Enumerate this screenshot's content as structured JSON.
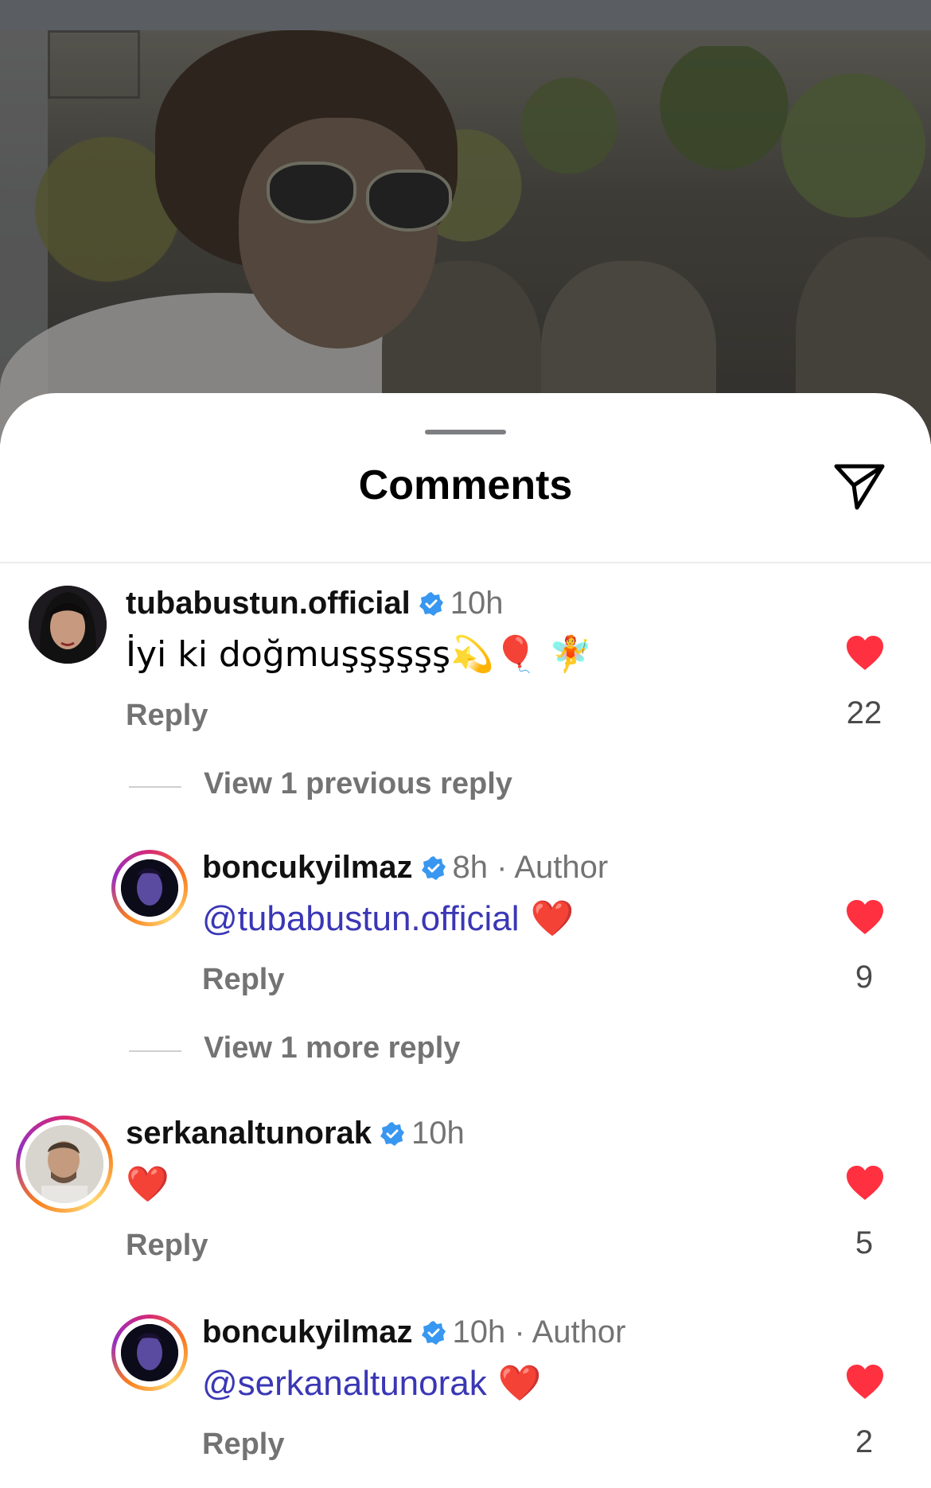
{
  "sheet": {
    "title": "Comments"
  },
  "comments": [
    {
      "username": "tubabustun.official",
      "time": "10h",
      "author_tag": "",
      "text": "İyi ki doğmuşşşşşş💫🎈 🧚",
      "mention": "",
      "reply_label": "Reply",
      "likes": "22",
      "liked": true
    },
    {
      "username": "boncukyilmaz",
      "time": "8h",
      "author_tag": "· Author",
      "mention": "@tubabustun.official",
      "text": " ❤️",
      "reply_label": "Reply",
      "likes": "9",
      "liked": true
    },
    {
      "username": "serkanaltunorak",
      "time": "10h",
      "author_tag": "",
      "text": "❤️",
      "mention": "",
      "reply_label": "Reply",
      "likes": "5",
      "liked": true
    },
    {
      "username": "boncukyilmaz",
      "time": "10h",
      "author_tag": "· Author",
      "mention": "@serkanaltunorak",
      "text": " ❤️",
      "reply_label": "Reply",
      "likes": "2",
      "liked": true
    }
  ],
  "threads": {
    "view_previous": "View 1 previous reply",
    "view_more": "View 1 more reply"
  },
  "colors": {
    "like_red": "#ff3040",
    "verified_blue": "#3897f0",
    "mention_blue": "#3a37b5",
    "secondary_text": "#737373"
  },
  "icons": {
    "share": "paper-plane-icon",
    "verified": "verified-badge-icon",
    "like": "heart-icon"
  }
}
